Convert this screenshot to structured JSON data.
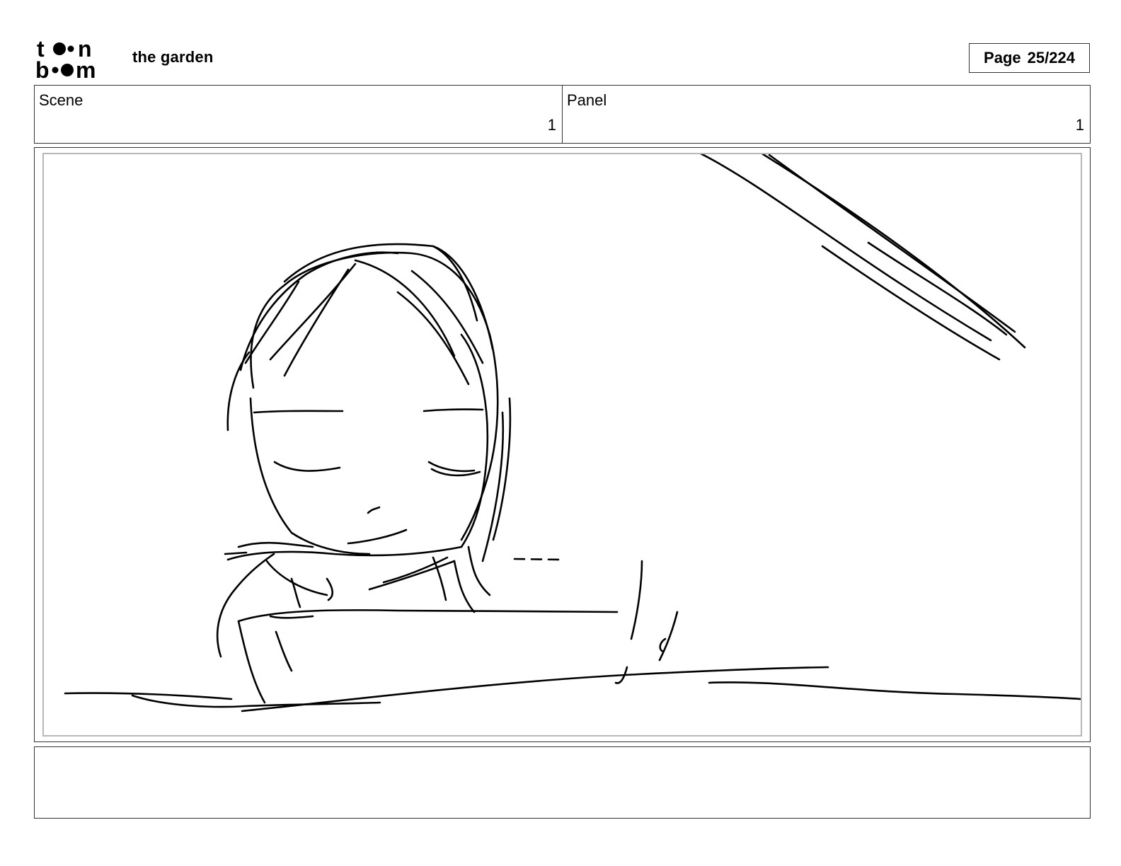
{
  "header": {
    "logo": {
      "line1": "toon",
      "line2": "boom",
      "icon": "toon-boom-logo"
    },
    "project_title": "the garden",
    "page_label": "Page",
    "page_number": "25/224"
  },
  "info": {
    "scene_label": "Scene",
    "scene_value": "1",
    "panel_label": "Panel",
    "panel_value": "1"
  },
  "panel_image": {
    "icon": "storyboard-sketch-girl-resting-head"
  },
  "notes": {
    "text": ""
  }
}
